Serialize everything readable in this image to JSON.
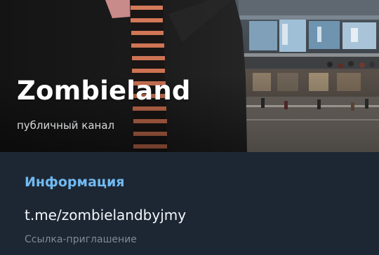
{
  "channel": {
    "title": "Zombieland",
    "subtitle": "публичный канал"
  },
  "info": {
    "header": "Информация",
    "link": "t.me/zombielandbyjmy",
    "link_caption": "Ссылка-приглашение"
  },
  "colors": {
    "section_header": "#71baf2",
    "background": "#1d2733",
    "primary_text": "#f3f6f9",
    "secondary_text": "#7f8b97"
  }
}
